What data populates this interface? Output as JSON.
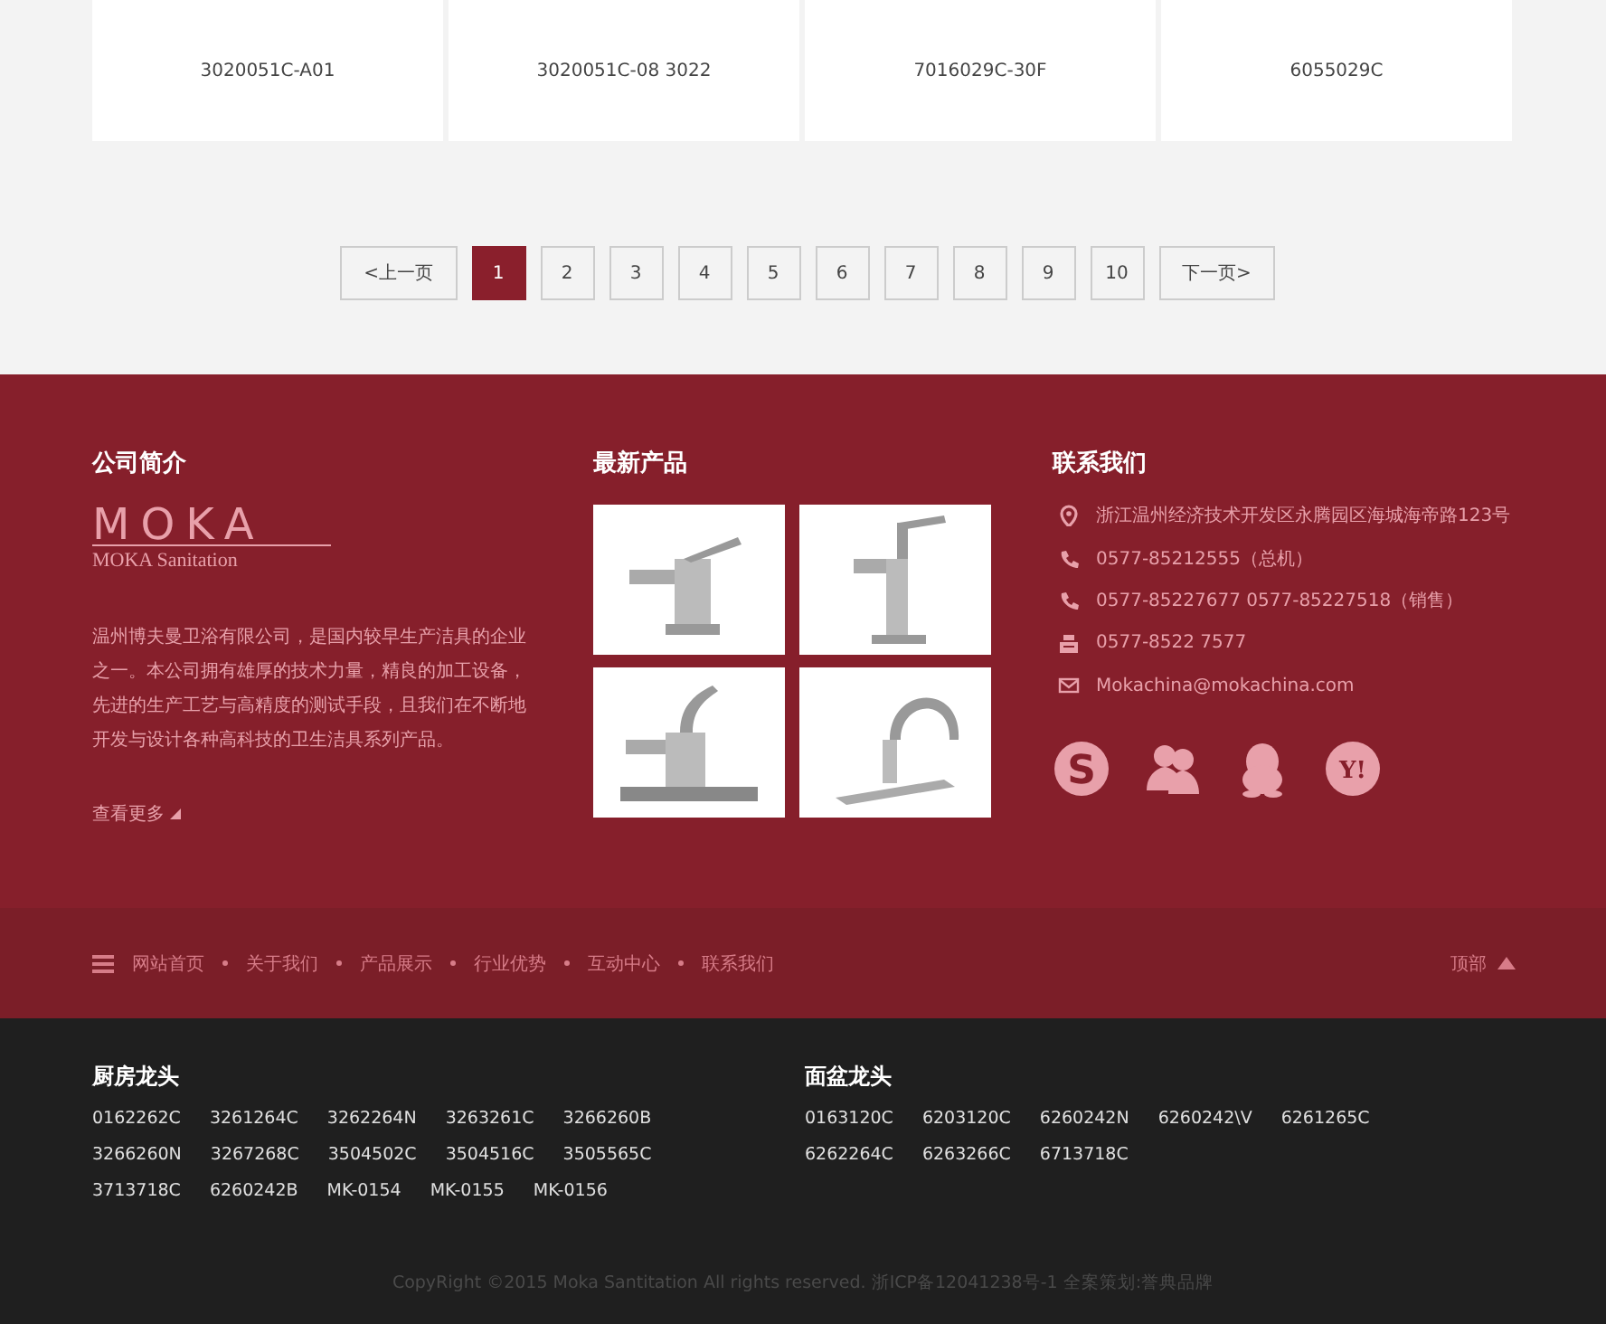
{
  "products": [
    {
      "code": "3020051C-A01"
    },
    {
      "code": "3020051C-08 3022"
    },
    {
      "code": "7016029C-30F"
    },
    {
      "code": "6055029C"
    }
  ],
  "pagination": [
    {
      "kind": "prev",
      "label": "<上一页",
      "selected": false
    },
    {
      "kind": "page",
      "label": "1",
      "selected": true
    },
    {
      "kind": "page",
      "label": "2",
      "selected": false
    },
    {
      "kind": "page",
      "label": "3",
      "selected": false
    },
    {
      "kind": "page",
      "label": "4",
      "selected": false
    },
    {
      "kind": "page",
      "label": "5",
      "selected": false
    },
    {
      "kind": "page",
      "label": "6",
      "selected": false
    },
    {
      "kind": "page",
      "label": "7",
      "selected": false
    },
    {
      "kind": "page",
      "label": "8",
      "selected": false
    },
    {
      "kind": "page",
      "label": "9",
      "selected": false
    },
    {
      "kind": "page",
      "label": "10",
      "selected": false
    },
    {
      "kind": "next",
      "label": "下一页>",
      "selected": false
    }
  ],
  "about": {
    "title": "公司简介",
    "logo": "MOKA",
    "logo_subtitle": "MOKA Sanitation",
    "text": "温州博夫曼卫浴有限公司，是国内较早生产洁具的企业之一。本公司拥有雄厚的技术力量，精良的加工设备，先进的生产工艺与高精度的测试手段，且我们在不断地开发与设计各种高科技的卫生洁具系列产品。",
    "more": "查看更多"
  },
  "latest_products": {
    "title": "最新产品",
    "images": [
      {
        "kind": "basin-faucet"
      },
      {
        "kind": "tall-faucet"
      },
      {
        "kind": "deck-faucet"
      },
      {
        "kind": "kitchen-faucet"
      }
    ]
  },
  "contact": {
    "title": "联系我们",
    "items": [
      {
        "kind": "address",
        "text": "浙江温州经济技术开发区永腾园区海城海帝路123号"
      },
      {
        "kind": "phone",
        "text": "0577-85212555（总机）"
      },
      {
        "kind": "phone",
        "text": "0577-85227677 0577-85227518（销售）"
      },
      {
        "kind": "fax",
        "text": "0577-8522 7577"
      },
      {
        "kind": "email",
        "text": "Mokachina@mokachina.com"
      }
    ],
    "social": [
      {
        "kind": "skype",
        "glyph": "S"
      },
      {
        "kind": "group"
      },
      {
        "kind": "qq"
      },
      {
        "kind": "yahoo",
        "glyph": "Y!"
      }
    ]
  },
  "footer_nav": {
    "links": [
      "网站首页",
      "关于我们",
      "产品展示",
      "行业优势",
      "互动中心",
      "联系我们"
    ],
    "top": "顶部"
  },
  "categories": [
    {
      "title": "厨房龙头",
      "codes": [
        "0162262C",
        "3261264C",
        "3262264N",
        "3263261C",
        "3266260B",
        "3266260N",
        "3267268C",
        "3504502C",
        "3504516C",
        "3505565C",
        "3713718C",
        "6260242B",
        "MK-0154",
        "MK-0155",
        "MK-0156"
      ]
    },
    {
      "title": "面盆龙头",
      "codes": [
        "0163120C",
        "6203120C",
        "6260242N",
        "6260242\\V",
        "6261265C",
        "6262264C",
        "6263266C",
        "6713718C"
      ]
    }
  ],
  "copyright": "CopyRight ©2015 Moka Santitation All rights reserved. 浙ICP备12041238号-1 全案策划:誉典品牌"
}
